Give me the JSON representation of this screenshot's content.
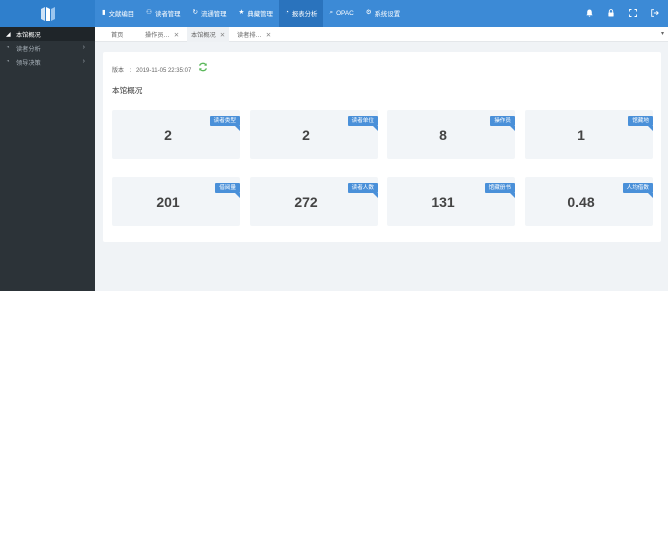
{
  "topbar": {
    "nav": [
      {
        "icon": "book-icon",
        "glyph": "▮",
        "label": "文献编目"
      },
      {
        "icon": "users-icon",
        "glyph": "⚇",
        "label": "读者管理"
      },
      {
        "icon": "refresh-icon",
        "glyph": "↻",
        "label": "流通管理"
      },
      {
        "icon": "star-icon",
        "glyph": "★",
        "label": "典藏管理"
      },
      {
        "icon": "pie-chart-icon",
        "glyph": "◔",
        "label": "报表分析"
      },
      {
        "icon": "search-icon",
        "glyph": "⌕",
        "label": "OPAC"
      },
      {
        "icon": "gear-icon",
        "glyph": "⚙",
        "label": "系统设置"
      }
    ]
  },
  "sidebar": {
    "items": [
      {
        "icon": "area-chart-icon",
        "glyph": "◢",
        "label": "本馆概况",
        "active": true,
        "arrow": ""
      },
      {
        "icon": "pie-chart-icon",
        "glyph": "◔",
        "label": "读者分析",
        "active": false,
        "arrow": "›"
      },
      {
        "icon": "pie-chart-icon",
        "glyph": "◔",
        "label": "领导决策",
        "active": false,
        "arrow": "›"
      }
    ]
  },
  "tabs": [
    {
      "label": "首页",
      "closable": false
    },
    {
      "label": "操作员…",
      "closable": true
    },
    {
      "label": "本馆概况",
      "closable": true,
      "active": true
    },
    {
      "label": "读者排…",
      "closable": true
    }
  ],
  "overview": {
    "version_label": "版本",
    "version_sep": ":",
    "version_date": "2019-11-05 22:35:07",
    "title": "本馆概况",
    "cards": [
      {
        "label": "读者类型",
        "value": "2"
      },
      {
        "label": "读者单位",
        "value": "2"
      },
      {
        "label": "操作员",
        "value": "8"
      },
      {
        "label": "馆藏地",
        "value": "1"
      },
      {
        "label": "借阅量",
        "value": "201"
      },
      {
        "label": "读者人数",
        "value": "272"
      },
      {
        "label": "馆藏册书",
        "value": "131"
      },
      {
        "label": "人均借数",
        "value": "0.48"
      }
    ]
  },
  "colors": {
    "header": "#3c8ad6",
    "sidebar": "#2c3338",
    "badge": "#4a90d9",
    "refresh": "#5cb85c"
  }
}
